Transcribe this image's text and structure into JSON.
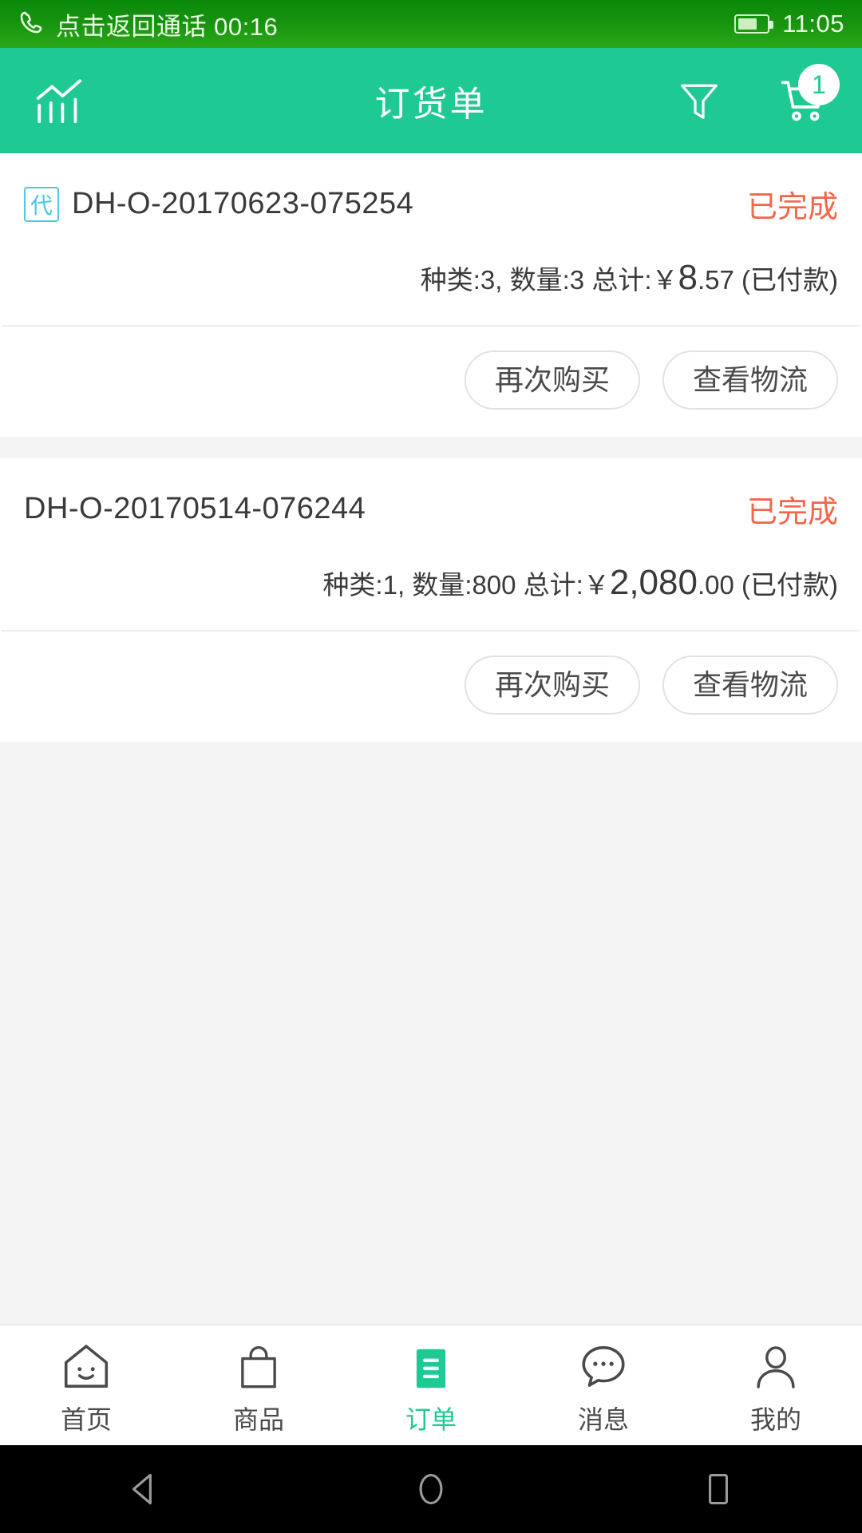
{
  "status_bar": {
    "call_icon": "phone-call-icon",
    "call_text": "点击返回通话 00:16",
    "battery_icon": "battery-icon",
    "battery_level_percent": 58,
    "time": "11:05"
  },
  "app_bar": {
    "left_icon": "chart-statistics-icon",
    "title": "订货单",
    "filter_icon": "filter-funnel-icon",
    "cart_icon": "shopping-cart-icon",
    "cart_badge_count": "1",
    "accent_color": "#1ec994"
  },
  "orders": [
    {
      "proxy_badge": "代",
      "order_no": "DH-O-20170623-075254",
      "status": "已完成",
      "status_color": "#f4654a",
      "summary_prefix": "种类:3, 数量:3 总计:￥",
      "amount_main": "8",
      "amount_decimal": ".57",
      "payment_state": " (已付款)",
      "buttons": [
        "再次购买",
        "查看物流"
      ]
    },
    {
      "proxy_badge": "",
      "order_no": "DH-O-20170514-076244",
      "status": "已完成",
      "status_color": "#f4654a",
      "summary_prefix": "种类:1, 数量:800 总计:￥",
      "amount_main": "2,080",
      "amount_decimal": ".00",
      "payment_state": " (已付款)",
      "buttons": [
        "再次购买",
        "查看物流"
      ]
    }
  ],
  "tab_bar": {
    "items": [
      {
        "label": "首页",
        "icon": "home-house-icon",
        "active": false
      },
      {
        "label": "商品",
        "icon": "shopping-bag-icon",
        "active": false
      },
      {
        "label": "订单",
        "icon": "order-list-icon",
        "active": true
      },
      {
        "label": "消息",
        "icon": "chat-bubble-icon",
        "active": false
      },
      {
        "label": "我的",
        "icon": "user-person-icon",
        "active": false
      }
    ],
    "active_color": "#1ec994"
  },
  "android_nav": {
    "back_icon": "back-triangle-icon",
    "home_icon": "home-circle-icon",
    "recents_icon": "recents-square-icon"
  }
}
